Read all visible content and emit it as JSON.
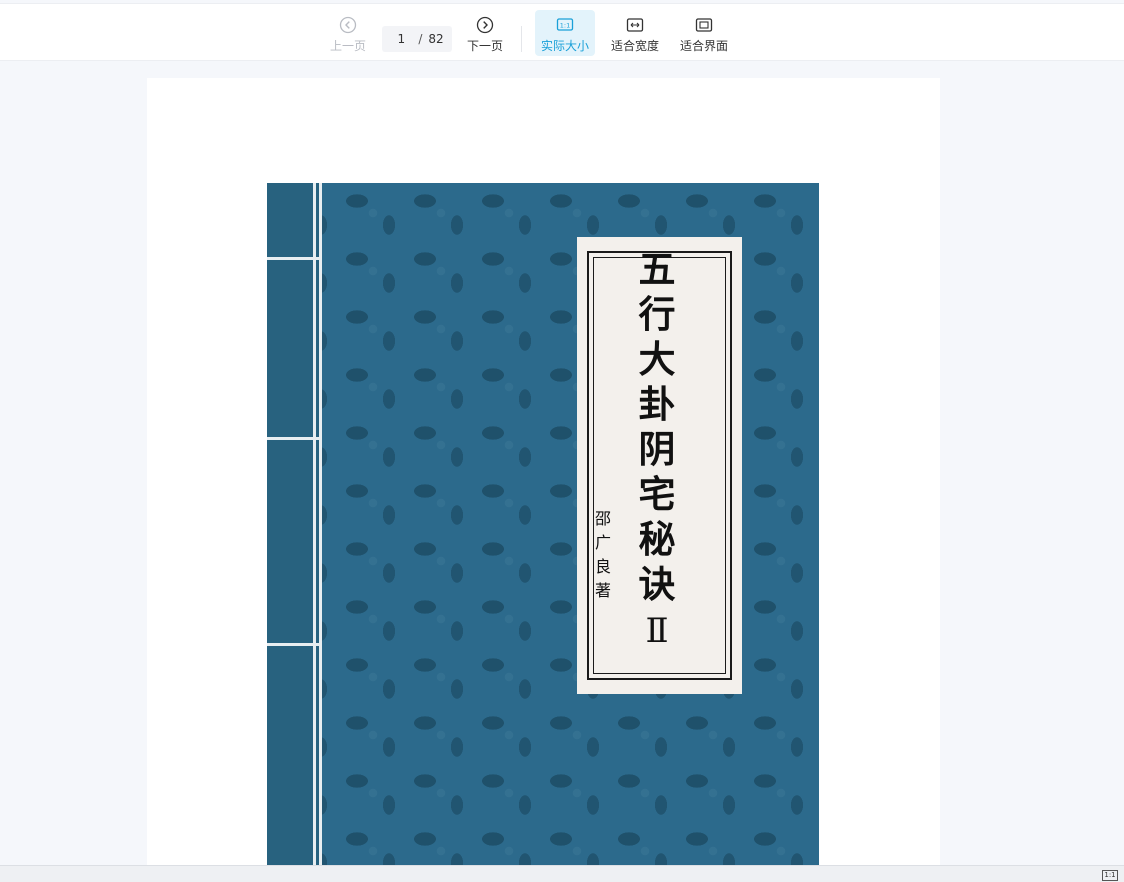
{
  "toolbar": {
    "prev_label": "上一页",
    "next_label": "下一页",
    "page_current": "1",
    "page_separator": "/",
    "page_total": "82",
    "actual_size_label": "实际大小",
    "actual_size_icon_text": "1:1",
    "fit_width_label": "适合宽度",
    "fit_page_label": "适合界面",
    "active_color": "#1aa0d8"
  },
  "document": {
    "cover_title_chars": [
      "五",
      "行",
      "大",
      "卦",
      "阴",
      "宅",
      "秘",
      "诀"
    ],
    "cover_volume": "Ⅱ",
    "cover_author_chars": [
      "邵",
      "广",
      "良",
      "著"
    ],
    "cover_color": "#2c6a8c"
  },
  "statusbar": {
    "zoom_icon_text": "1:1"
  }
}
